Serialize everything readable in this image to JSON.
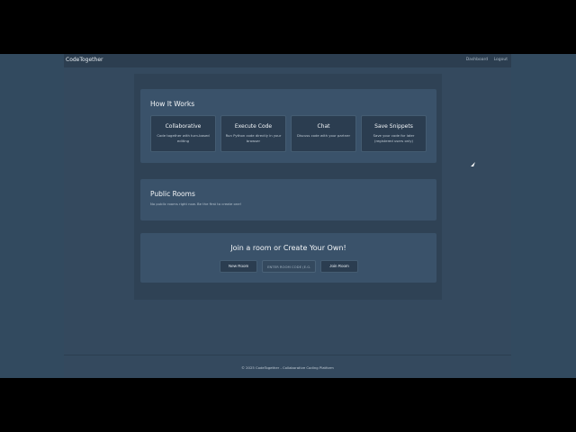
{
  "navbar": {
    "brand": "CodeTogether",
    "links": [
      "Dashboard",
      "Logout"
    ]
  },
  "how_it_works": {
    "title": "How It Works",
    "features": [
      {
        "title": "Collaborative",
        "description": "Code together with turn-based editing"
      },
      {
        "title": "Execute Code",
        "description": "Run Python code directly in your browser"
      },
      {
        "title": "Chat",
        "description": "Discuss code with your partner"
      },
      {
        "title": "Save Snippets",
        "description": "Save your code for later (registered users only)"
      }
    ]
  },
  "public_rooms": {
    "title": "Public Rooms",
    "empty_message": "No public rooms right now. Be the first to create one!"
  },
  "join": {
    "title": "Join a room or Create Your Own!",
    "new_room_label": "New Room",
    "room_code_placeholder": "ENTER ROOM CODE (E.G.",
    "join_room_label": "Join Room"
  },
  "footer": {
    "text": "© 2025 CodeTogether - Collaborative Coding Platform"
  },
  "colors": {
    "background": "#324a5f",
    "navbar": "#2c3e50",
    "panel": "#3a526a",
    "card": "#2b3d50"
  }
}
